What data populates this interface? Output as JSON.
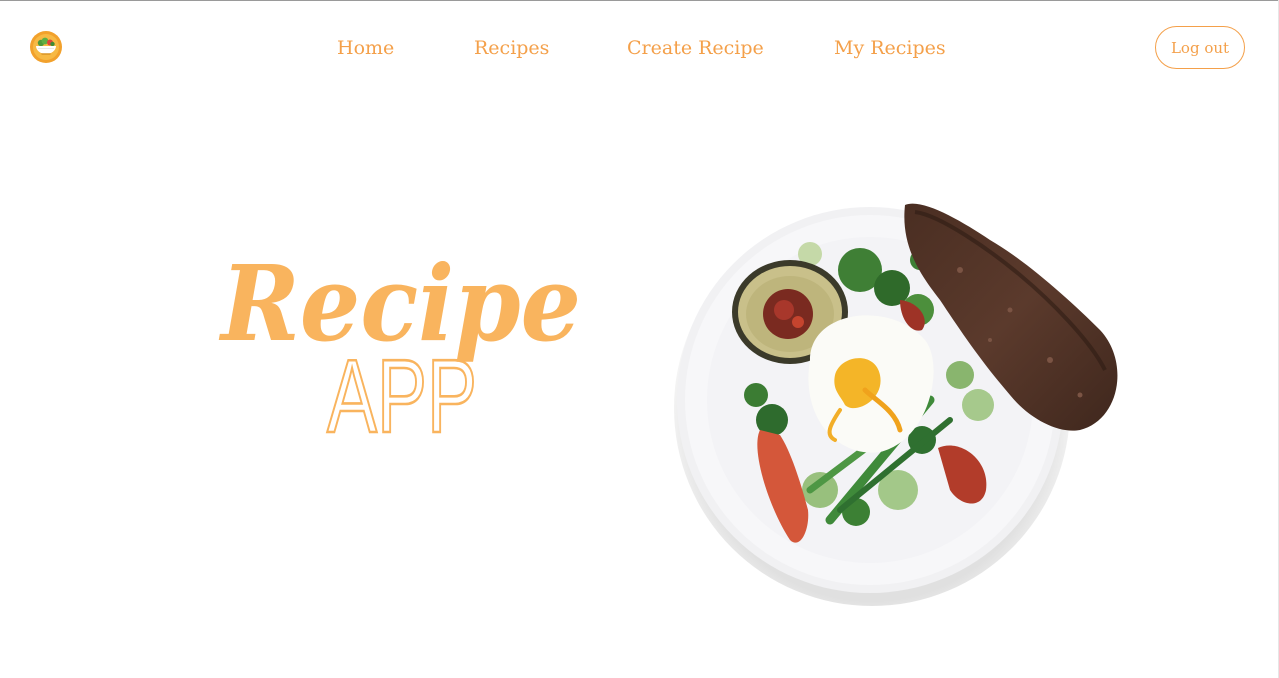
{
  "nav": {
    "logo_icon": "salad-bowl-icon",
    "links": [
      "Home",
      "Recipes",
      "Create Recipe",
      "My Recipes"
    ],
    "logout_label": "Log out"
  },
  "hero": {
    "title_script": "Recipe",
    "title_outline": "APP",
    "image": "plate-of-food-image"
  },
  "colors": {
    "accent": "#F4A04A",
    "hero_text": "#F9B45E"
  }
}
